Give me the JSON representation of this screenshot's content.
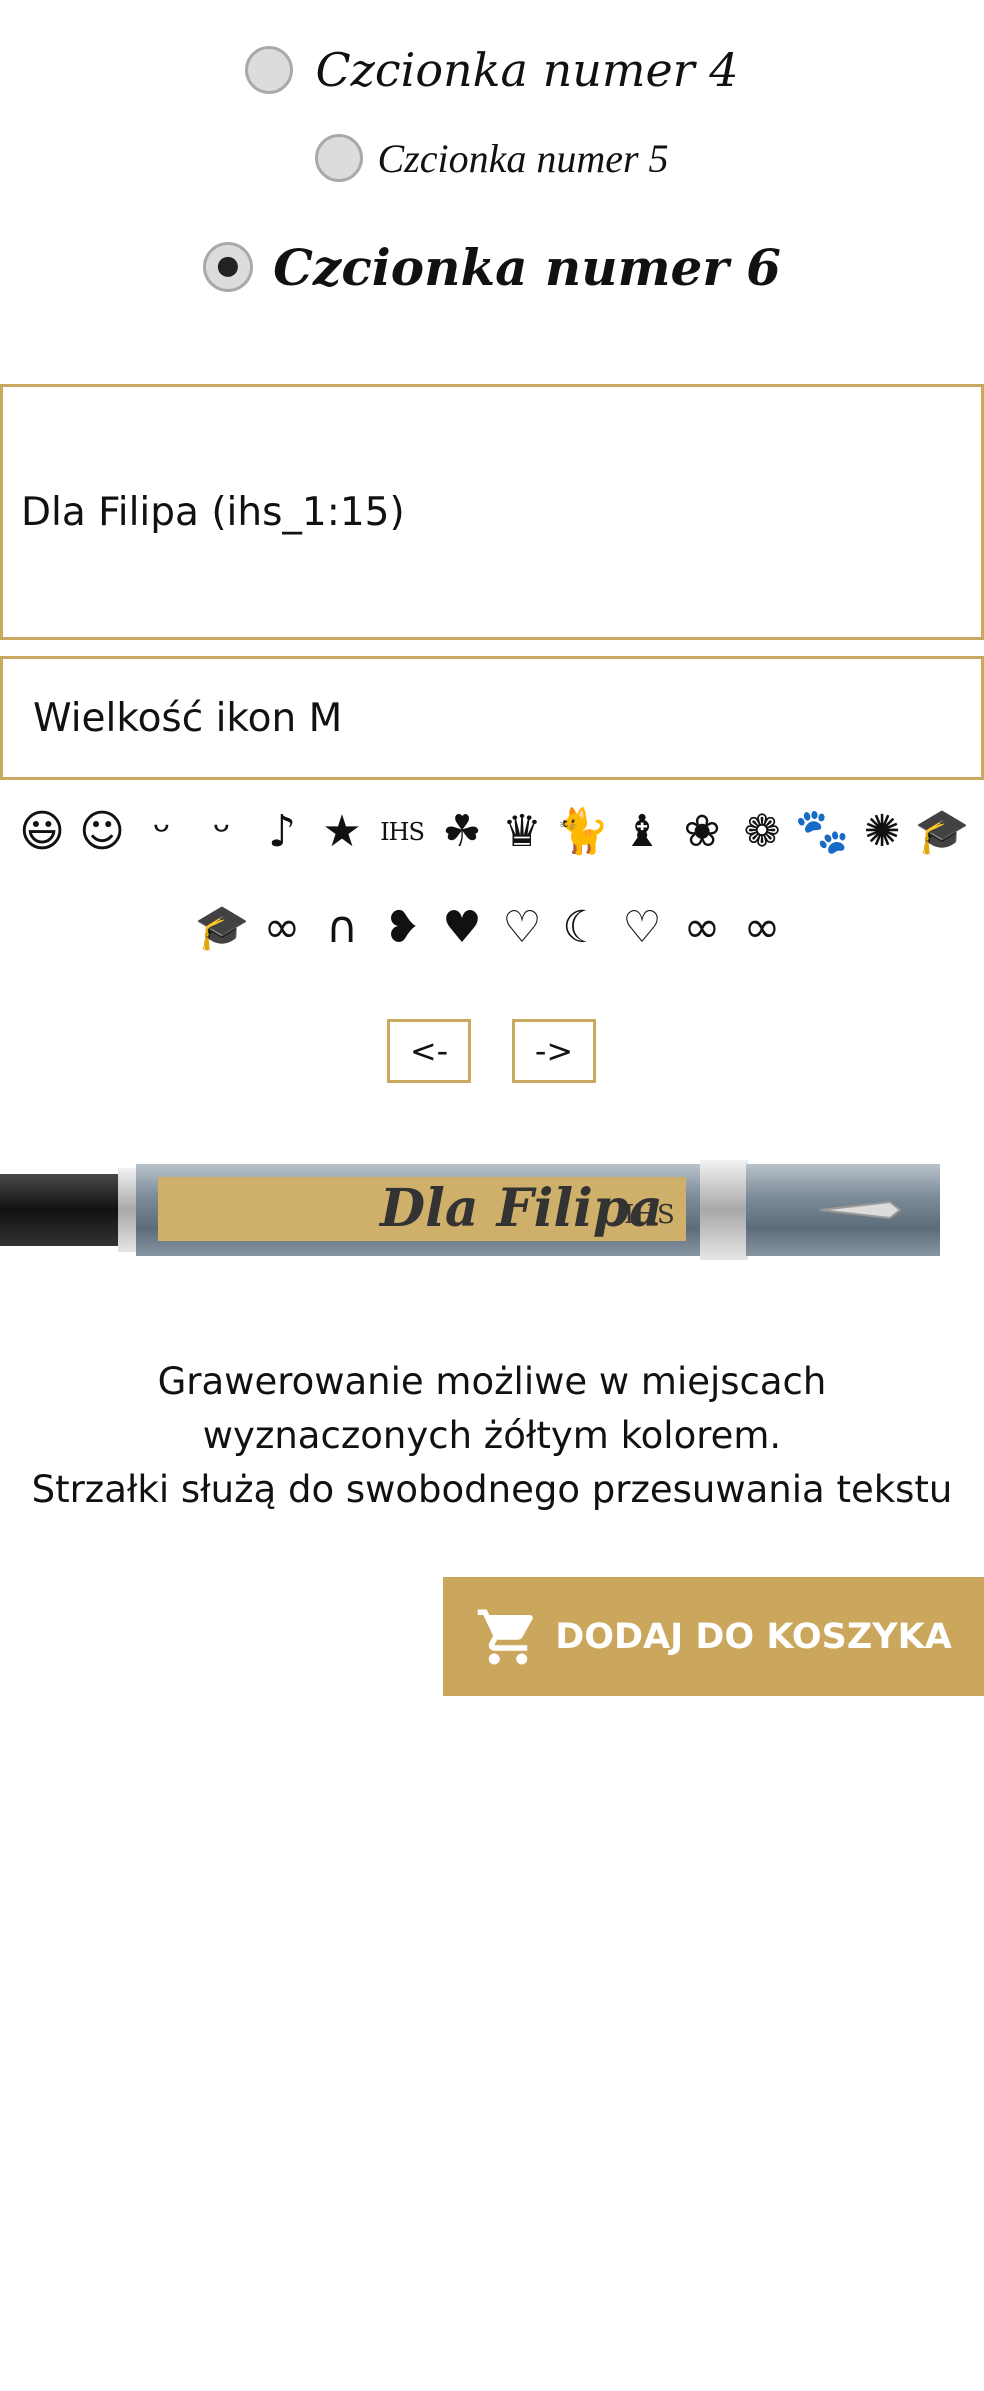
{
  "fonts": {
    "options": [
      {
        "label": "Czcionka numer 4",
        "selected": false
      },
      {
        "label": "Czcionka numer 5",
        "selected": false
      },
      {
        "label": "Czcionka numer 6",
        "selected": true
      }
    ]
  },
  "engraving": {
    "text_value": "Dla Filipa (ihs_1:15)"
  },
  "icon_size": {
    "selected": "Wielkość ikon M"
  },
  "icons": {
    "row1": [
      "😃",
      "☺",
      "ᵕ",
      "ᵕ",
      "♪",
      "★",
      "IHS",
      "☘",
      "♛",
      "🐈",
      "♝",
      "❀",
      "❁",
      "🐾",
      "✺",
      "🎓"
    ],
    "row2": [
      "🎓",
      "∞",
      "∩",
      "❥",
      "♥",
      "♡",
      "☾",
      "♡",
      "∞",
      "∞"
    ],
    "row1_names": [
      "big-smile-icon",
      "smile-icon",
      "happy-face-icon",
      "grin-face-icon",
      "notes-icon",
      "star-icon",
      "ihs-icon",
      "clover-icon",
      "crown-icon",
      "cat-icon",
      "tie-icon",
      "rose-icon",
      "rose-bud-icon",
      "paw-icon",
      "rosette-icon",
      "graduation-cap-icon"
    ],
    "row2_names": [
      "graduation-cap-icon",
      "rings-icon",
      "horseshoe-icon",
      "heart-ribbon-icon",
      "heart-filled-icon",
      "heart-outline-icon",
      "moon-heart-icon",
      "heart-dotted-icon",
      "infinity-icon",
      "infinity-outline-icon"
    ]
  },
  "nav": {
    "left_label": "<-",
    "right_label": "->"
  },
  "preview": {
    "engraving_text": "Dla Filipa",
    "ihs_mark": "IHS"
  },
  "info": {
    "line1": "Grawerowanie możliwe w miejscach",
    "line2": "wyznaczonych żółtym kolorem.",
    "line3": "Strzałki służą do swobodnego przesuwania tekstu"
  },
  "cart": {
    "label": "DODAJ DO KOSZYKA"
  },
  "colors": {
    "accent": "#caa75d",
    "border": "#c9a85f",
    "engrave_area": "#cfb06a"
  }
}
